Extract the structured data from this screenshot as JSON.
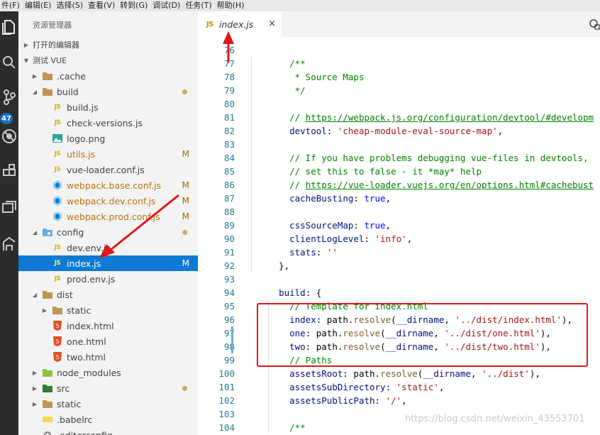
{
  "menubar": {
    "items": [
      "件(F)",
      "编辑(E)",
      "选择(S)",
      "查看(V)",
      "转到(G)",
      "调试(D)",
      "任务(T)",
      "帮助(H)"
    ]
  },
  "activitybar": {
    "icons": [
      "files-icon",
      "search-icon",
      "source-control-icon",
      "debug-icon",
      "extensions-icon",
      "remote-icon",
      "deploy-icon"
    ],
    "badge": "47"
  },
  "sidebar": {
    "title": "资源管理器",
    "sections": [
      {
        "label": "打开的编辑器",
        "expanded": false
      },
      {
        "label": "测试 VUE",
        "expanded": true
      }
    ],
    "tree": [
      {
        "label": ".cache",
        "kind": "folder",
        "indent": 0,
        "expanded": false,
        "status": ""
      },
      {
        "label": "build",
        "kind": "folder",
        "indent": 0,
        "expanded": true,
        "status": "dot"
      },
      {
        "label": "build.js",
        "kind": "js",
        "indent": 1,
        "status": ""
      },
      {
        "label": "check-versions.js",
        "kind": "js",
        "indent": 1,
        "status": ""
      },
      {
        "label": "logo.png",
        "kind": "image",
        "indent": 1,
        "status": ""
      },
      {
        "label": "utils.js",
        "kind": "js",
        "indent": 1,
        "status": "M"
      },
      {
        "label": "vue-loader.conf.js",
        "kind": "js",
        "indent": 1,
        "status": ""
      },
      {
        "label": "webpack.base.conf.js",
        "kind": "webpack",
        "indent": 1,
        "status": "M"
      },
      {
        "label": "webpack.dev.conf.js",
        "kind": "webpack",
        "indent": 1,
        "status": "M"
      },
      {
        "label": "webpack.prod.conf.js",
        "kind": "webpack",
        "indent": 1,
        "status": "M"
      },
      {
        "label": "config",
        "kind": "folder-config",
        "indent": 0,
        "expanded": true,
        "status": "dot"
      },
      {
        "label": "dev.env.js",
        "kind": "js",
        "indent": 1,
        "status": ""
      },
      {
        "label": "index.js",
        "kind": "js",
        "indent": 1,
        "status": "M",
        "selected": true
      },
      {
        "label": "prod.env.js",
        "kind": "js",
        "indent": 1,
        "status": ""
      },
      {
        "label": "dist",
        "kind": "folder",
        "indent": 0,
        "expanded": true,
        "status": ""
      },
      {
        "label": "static",
        "kind": "folder",
        "indent": 1,
        "expanded": false,
        "status": ""
      },
      {
        "label": "index.html",
        "kind": "html",
        "indent": 1,
        "status": ""
      },
      {
        "label": "one.html",
        "kind": "html",
        "indent": 1,
        "status": ""
      },
      {
        "label": "two.html",
        "kind": "html",
        "indent": 1,
        "status": ""
      },
      {
        "label": "node_modules",
        "kind": "folder-node",
        "indent": 0,
        "expanded": false,
        "status": ""
      },
      {
        "label": "src",
        "kind": "folder-src",
        "indent": 0,
        "expanded": false,
        "status": "dot"
      },
      {
        "label": "static",
        "kind": "folder",
        "indent": 0,
        "expanded": false,
        "status": ""
      },
      {
        "label": ".babelrc",
        "kind": "babel",
        "indent": 0,
        "status": ""
      },
      {
        "label": ".editorconfig",
        "kind": "config",
        "indent": 0,
        "status": ""
      }
    ]
  },
  "tab": {
    "badge": "JS",
    "label": "index.js",
    "close": "×"
  },
  "editor": {
    "lines": [
      {
        "n": "76",
        "t": ""
      },
      {
        "n": "77",
        "t": "    /**"
      },
      {
        "n": "78",
        "t": "     * Source Maps"
      },
      {
        "n": "79",
        "t": "     */"
      },
      {
        "n": "80",
        "t": ""
      },
      {
        "n": "81",
        "t": "    // https://webpack.js.org/configuration/devtool/#developm"
      },
      {
        "n": "82",
        "t": "    devtool: 'cheap-module-eval-source-map',"
      },
      {
        "n": "83",
        "t": ""
      },
      {
        "n": "84",
        "t": "    // If you have problems debugging vue-files in devtools,"
      },
      {
        "n": "85",
        "t": "    // set this to false - it *may* help"
      },
      {
        "n": "86",
        "t": "    // https://vue-loader.vuejs.org/en/options.html#cachebust"
      },
      {
        "n": "87",
        "t": "    cacheBusting: true,"
      },
      {
        "n": "88",
        "t": ""
      },
      {
        "n": "89",
        "t": "    cssSourceMap: true,"
      },
      {
        "n": "90",
        "t": "    clientLogLevel: 'info',"
      },
      {
        "n": "91",
        "t": "    stats: ''"
      },
      {
        "n": "92",
        "t": "  },"
      },
      {
        "n": "93",
        "t": ""
      },
      {
        "n": "94",
        "t": "  build: {"
      },
      {
        "n": "95",
        "t": "    // Template for index.html"
      },
      {
        "n": "96",
        "t": "    index: path.resolve(__dirname, '../dist/index.html'),"
      },
      {
        "n": "97",
        "t": "    one: path.resolve(__dirname, '../dist/one.html'),"
      },
      {
        "n": "98",
        "t": "    two: path.resolve(__dirname, '../dist/two.html'),"
      },
      {
        "n": "99",
        "t": "    // Paths"
      },
      {
        "n": "100",
        "t": "    assetsRoot: path.resolve(__dirname, '../dist'),"
      },
      {
        "n": "101",
        "t": "    assetsSubDirectory: 'static',"
      },
      {
        "n": "102",
        "t": "    assetsPublicPath: '/',"
      },
      {
        "n": "103",
        "t": ""
      },
      {
        "n": "104",
        "t": "    /**"
      }
    ]
  },
  "watermark": "https://blog.csdn.net/weixin_43553701",
  "colors": {
    "selection": "#0e7ad3",
    "annotation": "#e0161a",
    "jsIcon": "#d9b000"
  }
}
